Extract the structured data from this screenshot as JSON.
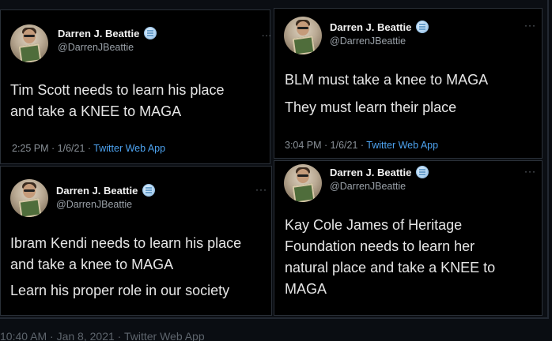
{
  "tweets": [
    {
      "name": "Darren J. Beattie",
      "handle": "@DarrenJBeattie",
      "more": "...",
      "lines": [
        "Tim Scott needs to learn his place",
        "and take a KNEE to MAGA"
      ],
      "time": "2:25 PM · 1/6/21 · ",
      "app": "Twitter Web App"
    },
    {
      "name": "Darren J. Beattie",
      "handle": "@DarrenJBeattie",
      "more": "···",
      "lines": [
        "BLM must take a knee to MAGA",
        "They must learn their place"
      ],
      "time": "3:04 PM · 1/6/21 · ",
      "app": "Twitter Web App"
    },
    {
      "name": "Darren J. Beattie",
      "handle": "@DarrenJBeattie",
      "more": "···",
      "lines": [
        "Ibram Kendi needs to learn his place",
        "and take a knee to MAGA",
        "Learn his proper role in our society"
      ]
    },
    {
      "name": "Darren J. Beattie",
      "handle": "@DarrenJBeattie",
      "more": "···",
      "lines": [
        "Kay Cole James of Heritage",
        "Foundation needs to learn her",
        "natural place and take a KNEE to",
        "MAGA"
      ]
    }
  ],
  "footer": {
    "text": "10:40 AM · Jan 8, 2021 · Twitter Web App"
  },
  "colors": {
    "link": "#4da3f0",
    "background": "#000000"
  }
}
